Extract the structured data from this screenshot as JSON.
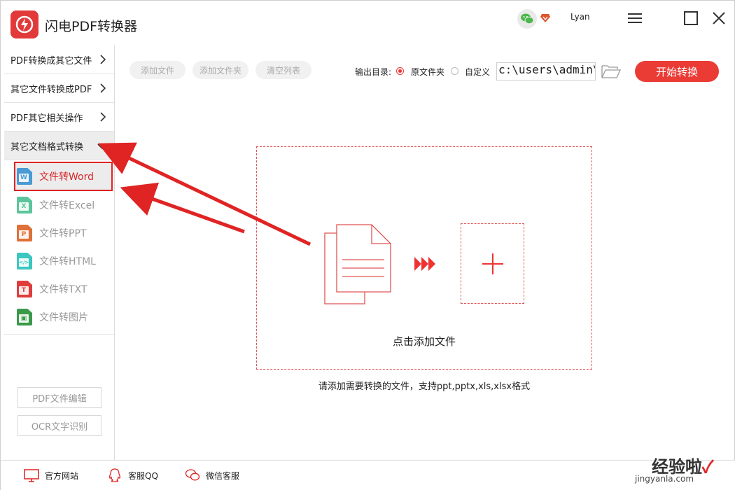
{
  "app": {
    "title": "闪电PDF转换器",
    "user": "Lyan",
    "brand_color": "#e23a3a"
  },
  "sidebar": {
    "menus": [
      {
        "label": "PDF转换成其它文件",
        "icon": "chevron-right-icon"
      },
      {
        "label": "其它文件转换成PDF",
        "icon": "chevron-right-icon"
      },
      {
        "label": "PDF其它相关操作",
        "icon": "chevron-right-icon"
      },
      {
        "label": "其它文档格式转换",
        "icon": "chevron-down-icon"
      }
    ],
    "sub_items": [
      {
        "label": "文件转Word",
        "icon": "word-file-icon",
        "badge": "W",
        "color": "#4a9ad4"
      },
      {
        "label": "文件转Excel",
        "icon": "excel-file-icon",
        "badge": "X",
        "color": "#5cc59b"
      },
      {
        "label": "文件转PPT",
        "icon": "ppt-file-icon",
        "badge": "P",
        "color": "#e0703a"
      },
      {
        "label": "文件转HTML",
        "icon": "html-file-icon",
        "badge": "</>",
        "color": "#3cc6c0"
      },
      {
        "label": "文件转TXT",
        "icon": "txt-file-icon",
        "badge": "T",
        "color": "#e03c3c"
      },
      {
        "label": "文件转图片",
        "icon": "image-file-icon",
        "badge": "▣",
        "color": "#3b9a4a"
      }
    ],
    "buttons": {
      "pdf_edit": "PDF文件编辑",
      "ocr": "OCR文字识别"
    }
  },
  "toolbar": {
    "add_file": "添加文件",
    "add_folder": "添加文件夹",
    "clear_list": "清空列表",
    "output_label": "输出目录:",
    "option_original": "原文件夹",
    "option_custom": "自定义",
    "output_path": "c:\\users\\admin\\d",
    "start": "开始转换",
    "accent": "#ea3b35"
  },
  "dropzone": {
    "title": "点击添加文件",
    "hint": "请添加需要转换的文件，支持ppt,pptx,xls,xlsx格式"
  },
  "footer": {
    "website": "官方网站",
    "qq": "客服QQ",
    "wechat": "微信客服"
  },
  "watermark": {
    "main": "经验啦",
    "sub": "jingyanla.com"
  }
}
